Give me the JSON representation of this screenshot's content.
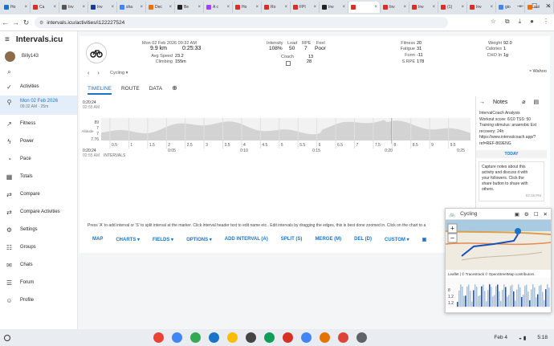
{
  "browser": {
    "tabs": [
      {
        "label": "Ho",
        "color": "#1a73c8"
      },
      {
        "label": "Ca",
        "color": "#d93025"
      },
      {
        "label": "Inv",
        "color": "#555555"
      },
      {
        "label": "Inv",
        "color": "#1a3c8c"
      },
      {
        "label": "sha",
        "color": "#4285f4"
      },
      {
        "label": "Dec",
        "color": "#e8710a"
      },
      {
        "label": "Be",
        "color": "#222222"
      },
      {
        "label": "A c",
        "color": "#a142f4"
      },
      {
        "label": "Ho",
        "color": "#d93025"
      },
      {
        "label": "Ro",
        "color": "#d93025"
      },
      {
        "label": "FPI",
        "color": "#d93025"
      },
      {
        "label": "Inv",
        "color": "#222222"
      },
      {
        "label": "",
        "color": "#d93025",
        "active": true
      },
      {
        "label": "Inv",
        "color": "#d93025"
      },
      {
        "label": "Inv",
        "color": "#d93025"
      },
      {
        "label": "(1)",
        "color": "#d93025"
      },
      {
        "label": "Inv",
        "color": "#d93025"
      },
      {
        "label": "gio",
        "color": "#4285f4"
      },
      {
        "label": "aut",
        "color": "#e8710a"
      }
    ],
    "url": "intervals.icu/activities/i122227524"
  },
  "sidebar": {
    "brand": "Intervals.icu",
    "user": "Billy143",
    "items": [
      {
        "label": "Activities",
        "icon": "check-icon"
      },
      {
        "label": "Mon 02 Feb 2026",
        "sub": "09:32 AM · 25m",
        "icon": "bike-icon",
        "selected": true
      },
      {
        "label": "Fitness",
        "icon": "trend-icon"
      },
      {
        "label": "Power",
        "icon": "bolt-icon"
      },
      {
        "label": "Pace",
        "icon": "run-icon"
      },
      {
        "label": "Totals",
        "icon": "table-icon"
      },
      {
        "label": "Compare",
        "icon": "compare-icon"
      },
      {
        "label": "Compare Activities",
        "icon": "compare-icon"
      },
      {
        "label": "Settings",
        "icon": "gear-icon"
      },
      {
        "label": "Groups",
        "icon": "group-icon"
      },
      {
        "label": "Chats",
        "icon": "chat-icon"
      },
      {
        "label": "Forum",
        "icon": "forum-icon"
      },
      {
        "label": "Profile",
        "icon": "profile-icon"
      }
    ]
  },
  "activity": {
    "date": "Mon 02 Feb 2026",
    "time": "09:32 AM",
    "distance": "9.9 km",
    "duration": "0:25:33",
    "avg_speed_label": "Avg Speed",
    "avg_speed": "23.2",
    "climbing_label": "Climbing",
    "climbing": "155m",
    "type": "Cycling",
    "intensity_label": "Intensity",
    "intensity": "108%",
    "load_label": "Load",
    "load": "50",
    "rpe_label": "RPE",
    "rpe": "7",
    "feel_label": "Feel",
    "feel": "Poor",
    "coach_label": "Coach",
    "coach_up": "13",
    "coach_down": "28",
    "fitness_label": "Fitness",
    "fitness": "20",
    "fatigue_label": "Fatigue",
    "fatigue": "31",
    "form_label": "Form",
    "form": "-11",
    "srpe_label": "S.RPE",
    "srpe": "178",
    "weight_label": "Weight",
    "weight": "92.0",
    "calories_label": "Calories",
    "calories": "1",
    "cho_label": "CHO In",
    "cho": "1g",
    "source": "Wahoo"
  },
  "view_tabs": [
    "TIMELINE",
    "ROUTE",
    "DATA"
  ],
  "chart": {
    "start_label": "0:20:24",
    "start_time": "02:55 AM",
    "end_label": "0:20:24",
    "end_time": "02:55 AM",
    "y_ticks": [
      "89",
      "7",
      "7",
      "7.76"
    ],
    "altitude_label": "Altitude",
    "x_ticks": [
      "0.5",
      "1",
      "1.5",
      "2",
      "2.5",
      "3",
      "3.5",
      "4",
      "4.5",
      "5",
      "5.5",
      "6",
      "6.5",
      "7",
      "7.5",
      "8",
      "8.5",
      "9",
      "9.5"
    ],
    "time_ticks": [
      "0:05",
      "0:10",
      "0:15",
      "0:20",
      "0:25"
    ],
    "intervals_label": "INTERVALS"
  },
  "hint": "Press 'A' to add interval or 'S' to split interval at the marker. Click interval header text to edit name etc.. Edit intervals by dragging the edges, this is best done zoomed in. Click on the chart to a",
  "actions": [
    "MAP",
    "CHARTS",
    "FIELDS",
    "OPTIONS",
    "ADD INTERVAL (A)",
    "SPLIT (S)",
    "MERGE (M)",
    "DEL (D)",
    "CUSTOM"
  ],
  "notes": {
    "title": "Notes",
    "lines": [
      "IntervalCoach Analysis",
      "Workout score: 6/10 TSS: 50",
      "Training stimulus: anaerobic Est",
      "recovery: 24h",
      "https://www.intervalcoach.app/?",
      "ref=REF-869ENG"
    ],
    "today": "TODAY",
    "note_lines": [
      "Capture notes about this",
      "activity and discuss it with",
      "your followers. Click the",
      "share button to share with",
      "others."
    ],
    "note_time": "03:15 PM"
  },
  "map": {
    "title": "Cycling",
    "attribution": "Leaflet | © Tracestrack © OpenStreetMap contributors",
    "ticks": [
      "8",
      "1.2",
      "1.2"
    ]
  },
  "shelf": {
    "date": "Feb 4",
    "time": "5:18"
  }
}
